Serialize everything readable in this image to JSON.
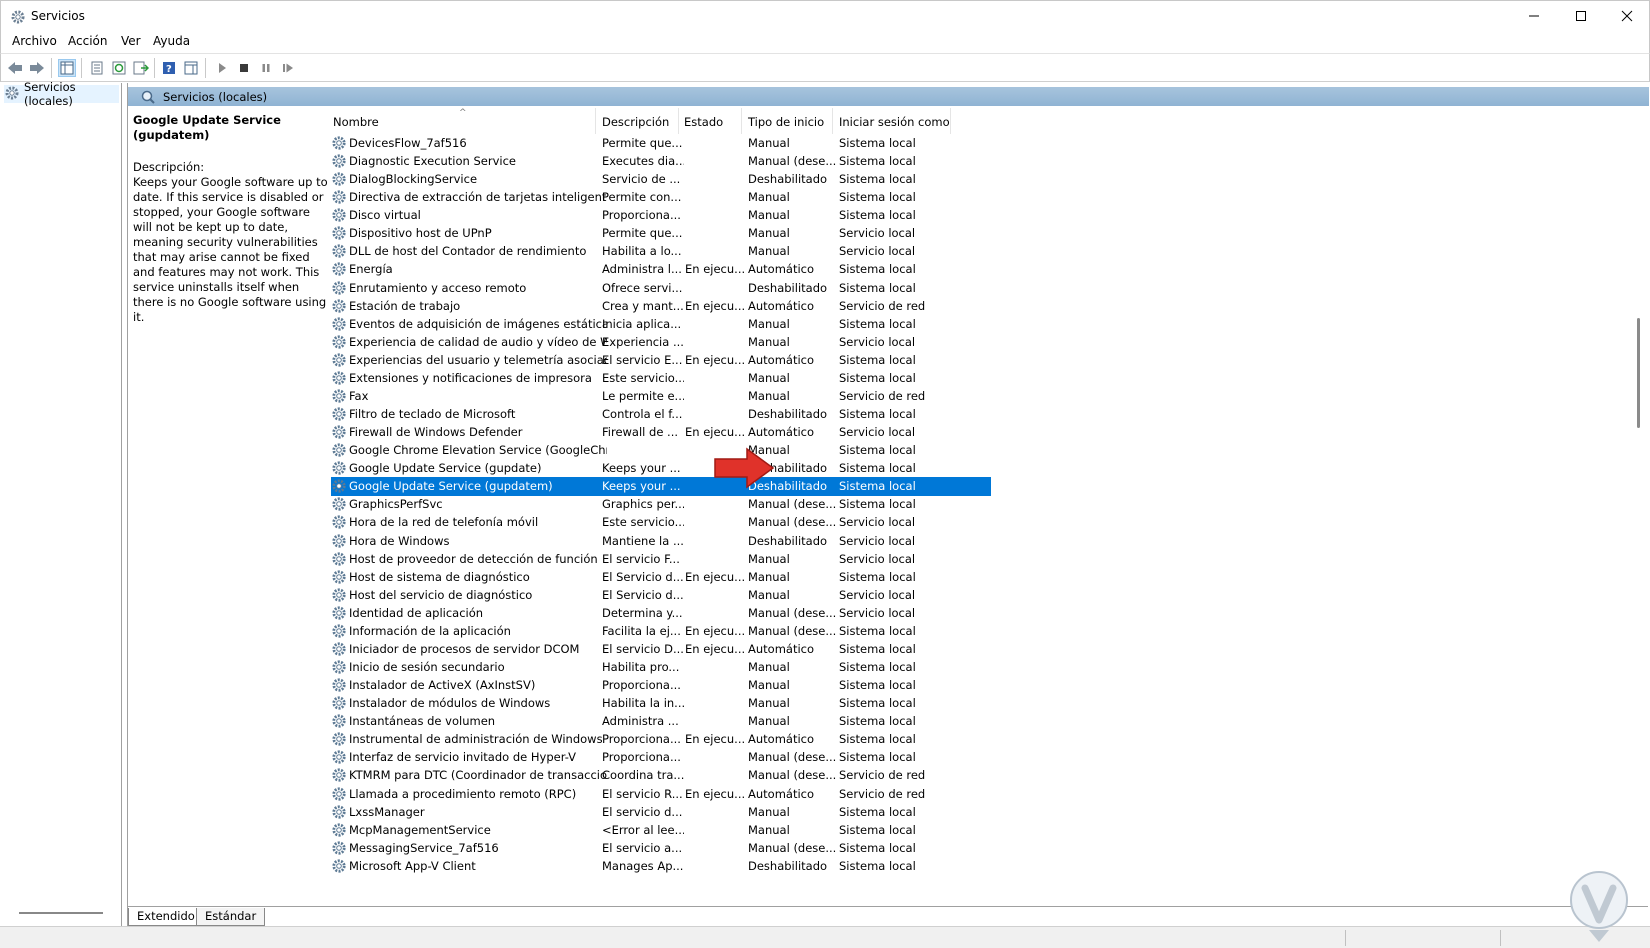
{
  "window": {
    "title": "Servicios"
  },
  "menu": [
    "Archivo",
    "Acción",
    "Ver",
    "Ayuda"
  ],
  "tree": {
    "item": "Servicios (locales)"
  },
  "pane_header": "Servicios (locales)",
  "details": {
    "title": "Google Update Service (gupdatem)",
    "desc_label": "Descripción:",
    "desc_text": "Keeps your Google software up to date. If this service is disabled or stopped, your Google software will not be kept up to date, meaning security vulnerabilities that may arise cannot be fixed and features may not work. This service uninstalls itself when there is no Google software using it."
  },
  "columns": [
    "Nombre",
    "Descripción",
    "Estado",
    "Tipo de inicio",
    "Iniciar sesión como"
  ],
  "rows": [
    [
      "DevicesFlow_7af516",
      "Permite que...",
      "",
      "Manual",
      "Sistema local"
    ],
    [
      "Diagnostic Execution Service",
      "Executes dia...",
      "",
      "Manual (dese...",
      "Sistema local"
    ],
    [
      "DialogBlockingService",
      "Servicio de ...",
      "",
      "Deshabilitado",
      "Sistema local"
    ],
    [
      "Directiva de extracción de tarjetas inteligentes",
      "Permite con...",
      "",
      "Manual",
      "Sistema local"
    ],
    [
      "Disco virtual",
      "Proporciona...",
      "",
      "Manual",
      "Sistema local"
    ],
    [
      "Dispositivo host de UPnP",
      "Permite que...",
      "",
      "Manual",
      "Servicio local"
    ],
    [
      "DLL de host del Contador de rendimiento",
      "Habilita a lo...",
      "",
      "Manual",
      "Servicio local"
    ],
    [
      "Energía",
      "Administra l...",
      "En ejecu...",
      "Automático",
      "Sistema local"
    ],
    [
      "Enrutamiento y acceso remoto",
      "Ofrece servi...",
      "",
      "Deshabilitado",
      "Sistema local"
    ],
    [
      "Estación de trabajo",
      "Crea y mant...",
      "En ejecu...",
      "Automático",
      "Servicio de red"
    ],
    [
      "Eventos de adquisición de imágenes estáticas",
      "Inicia aplica...",
      "",
      "Manual",
      "Sistema local"
    ],
    [
      "Experiencia de calidad de audio y vídeo de Wi...",
      "Experiencia ...",
      "",
      "Manual",
      "Servicio local"
    ],
    [
      "Experiencias del usuario y telemetría asociadas",
      "El servicio E...",
      "En ejecu...",
      "Automático",
      "Sistema local"
    ],
    [
      "Extensiones y notificaciones de impresora",
      "Este servicio...",
      "",
      "Manual",
      "Sistema local"
    ],
    [
      "Fax",
      "Le permite e...",
      "",
      "Manual",
      "Servicio de red"
    ],
    [
      "Filtro de teclado de Microsoft",
      "Controla el f...",
      "",
      "Deshabilitado",
      "Sistema local"
    ],
    [
      "Firewall de Windows Defender",
      "Firewall de ...",
      "En ejecu...",
      "Automático",
      "Servicio local"
    ],
    [
      "Google Chrome Elevation Service (GoogleChro...",
      "",
      "",
      "Manual",
      "Sistema local"
    ],
    [
      "Google Update Service (gupdate)",
      "Keeps your ...",
      "",
      "Deshabilitado",
      "Sistema local"
    ],
    [
      "Google Update Service (gupdatem)",
      "Keeps your ...",
      "",
      "Deshabilitado",
      "Sistema local"
    ],
    [
      "GraphicsPerfSvc",
      "Graphics per...",
      "",
      "Manual (dese...",
      "Sistema local"
    ],
    [
      "Hora de la red de telefonía móvil",
      "Este servicio...",
      "",
      "Manual (dese...",
      "Servicio local"
    ],
    [
      "Hora de Windows",
      "Mantiene la ...",
      "",
      "Deshabilitado",
      "Servicio local"
    ],
    [
      "Host de proveedor de detección de función",
      "El servicio F...",
      "",
      "Manual",
      "Servicio local"
    ],
    [
      "Host de sistema de diagnóstico",
      "El Servicio d...",
      "En ejecu...",
      "Manual",
      "Sistema local"
    ],
    [
      "Host del servicio de diagnóstico",
      "El Servicio d...",
      "",
      "Manual",
      "Servicio local"
    ],
    [
      "Identidad de aplicación",
      "Determina y...",
      "",
      "Manual (dese...",
      "Servicio local"
    ],
    [
      "Información de la aplicación",
      "Facilita la ej...",
      "En ejecu...",
      "Manual (dese...",
      "Sistema local"
    ],
    [
      "Iniciador de procesos de servidor DCOM",
      "El servicio D...",
      "En ejecu...",
      "Automático",
      "Sistema local"
    ],
    [
      "Inicio de sesión secundario",
      "Habilita pro...",
      "",
      "Manual",
      "Sistema local"
    ],
    [
      "Instalador de ActiveX (AxInstSV)",
      "Proporciona...",
      "",
      "Manual",
      "Sistema local"
    ],
    [
      "Instalador de módulos de Windows",
      "Habilita la in...",
      "",
      "Manual",
      "Sistema local"
    ],
    [
      "Instantáneas de volumen",
      "Administra ...",
      "",
      "Manual",
      "Sistema local"
    ],
    [
      "Instrumental de administración de Windows",
      "Proporciona...",
      "En ejecu...",
      "Automático",
      "Sistema local"
    ],
    [
      "Interfaz de servicio invitado de Hyper-V",
      "Proporciona...",
      "",
      "Manual (dese...",
      "Sistema local"
    ],
    [
      "KTMRM para DTC (Coordinador de transaccion...",
      "Coordina tra...",
      "",
      "Manual (dese...",
      "Servicio de red"
    ],
    [
      "Llamada a procedimiento remoto (RPC)",
      "El servicio R...",
      "En ejecu...",
      "Automático",
      "Servicio de red"
    ],
    [
      "LxssManager",
      "El servicio d...",
      "",
      "Manual",
      "Sistema local"
    ],
    [
      "McpManagementService",
      "<Error al lee...",
      "",
      "Manual",
      "Sistema local"
    ],
    [
      "MessagingService_7af516",
      "El servicio a...",
      "",
      "Manual (dese...",
      "Sistema local"
    ],
    [
      "Microsoft App-V Client",
      "Manages Ap...",
      "",
      "Deshabilitado",
      "Sistema local"
    ]
  ],
  "selected_row_index": 19,
  "tabs": [
    "Extendido",
    "Estándar"
  ],
  "colors": {
    "selection": "#0078d7",
    "header_bar": "#9dbcd8",
    "arrow": "#e0322a"
  }
}
